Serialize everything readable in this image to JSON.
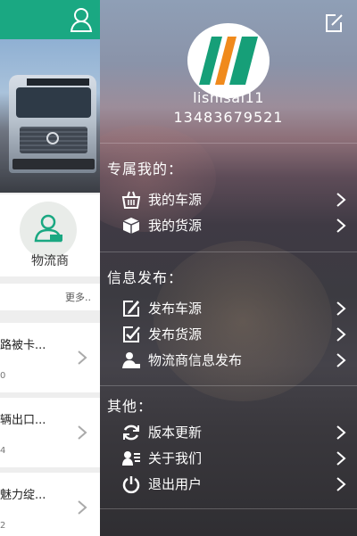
{
  "background_app": {
    "category_label": "物流商",
    "more_label": "更多..",
    "items": [
      {
        "title": "路被卡...",
        "sub": "0"
      },
      {
        "title": "辆出口...",
        "sub": "4"
      },
      {
        "title": "魅力绽...",
        "sub": "2"
      }
    ]
  },
  "drawer": {
    "username": "lishisai11",
    "phone": "13483679521",
    "sections": [
      {
        "title": "专属我的：",
        "items": [
          {
            "label": "我的车源",
            "icon": "basket-icon"
          },
          {
            "label": "我的货源",
            "icon": "box-icon"
          }
        ]
      },
      {
        "title": "信息发布：",
        "items": [
          {
            "label": "发布车源",
            "icon": "edit-pencil-icon"
          },
          {
            "label": "发布货源",
            "icon": "edit-check-icon"
          },
          {
            "label": "物流商信息发布",
            "icon": "person-icon"
          }
        ]
      },
      {
        "title": "其他：",
        "items": [
          {
            "label": "版本更新",
            "icon": "refresh-icon"
          },
          {
            "label": "关于我们",
            "icon": "contact-card-icon"
          },
          {
            "label": "退出用户",
            "icon": "power-icon"
          }
        ]
      }
    ]
  },
  "colors": {
    "brand_green": "#1aa882",
    "logo_green": "#169f78",
    "logo_orange": "#f08a1c"
  }
}
